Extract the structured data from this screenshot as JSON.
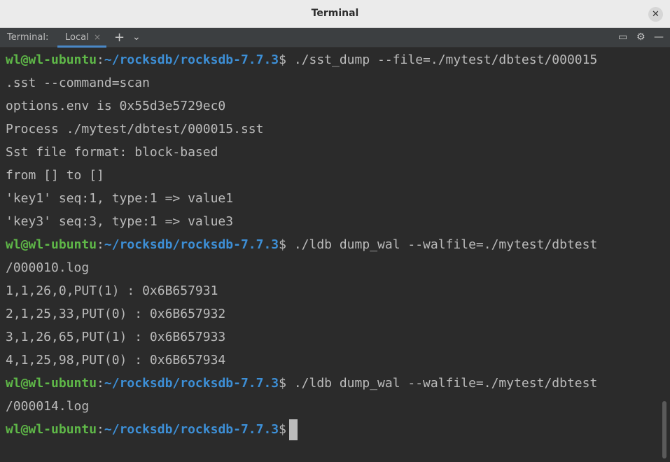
{
  "window": {
    "title": "Terminal",
    "close_glyph": "✕"
  },
  "toolbar": {
    "label": "Terminal:",
    "tab": {
      "label": "Local",
      "close_glyph": "×"
    },
    "new_tab_glyph": "+",
    "dropdown_glyph": "⌄",
    "icons": [
      "maximize-icon",
      "gear-icon",
      "minimize-icon"
    ],
    "icon_glyphs": [
      "▭",
      "⚙",
      "—"
    ]
  },
  "prompt": {
    "user": "wl@wl-ubuntu",
    "colon": ":",
    "path": "~/rocksdb/rocksdb-7.7.3",
    "symbol": "$"
  },
  "lines": [
    {
      "kind": "prompt",
      "cmd": " ./sst_dump --file=./mytest/dbtest/000015"
    },
    {
      "kind": "out",
      "text": ".sst --command=scan"
    },
    {
      "kind": "out",
      "text": "options.env is 0x55d3e5729ec0"
    },
    {
      "kind": "out",
      "text": "Process ./mytest/dbtest/000015.sst"
    },
    {
      "kind": "out",
      "text": "Sst file format: block-based"
    },
    {
      "kind": "out",
      "text": "from [] to []"
    },
    {
      "kind": "out",
      "text": "'key1' seq:1, type:1 => value1"
    },
    {
      "kind": "out",
      "text": "'key3' seq:3, type:1 => value3"
    },
    {
      "kind": "prompt",
      "cmd": " ./ldb dump_wal --walfile=./mytest/dbtest"
    },
    {
      "kind": "out",
      "text": "/000010.log"
    },
    {
      "kind": "out",
      "text": "1,1,26,0,PUT(1) : 0x6B657931"
    },
    {
      "kind": "out",
      "text": "2,1,25,33,PUT(0) : 0x6B657932"
    },
    {
      "kind": "out",
      "text": "3,1,26,65,PUT(1) : 0x6B657933"
    },
    {
      "kind": "out",
      "text": "4,1,25,98,PUT(0) : 0x6B657934"
    },
    {
      "kind": "prompt",
      "cmd": " ./ldb dump_wal --walfile=./mytest/dbtest"
    },
    {
      "kind": "out",
      "text": "/000014.log"
    },
    {
      "kind": "prompt",
      "cmd": "",
      "cursor": true
    }
  ]
}
